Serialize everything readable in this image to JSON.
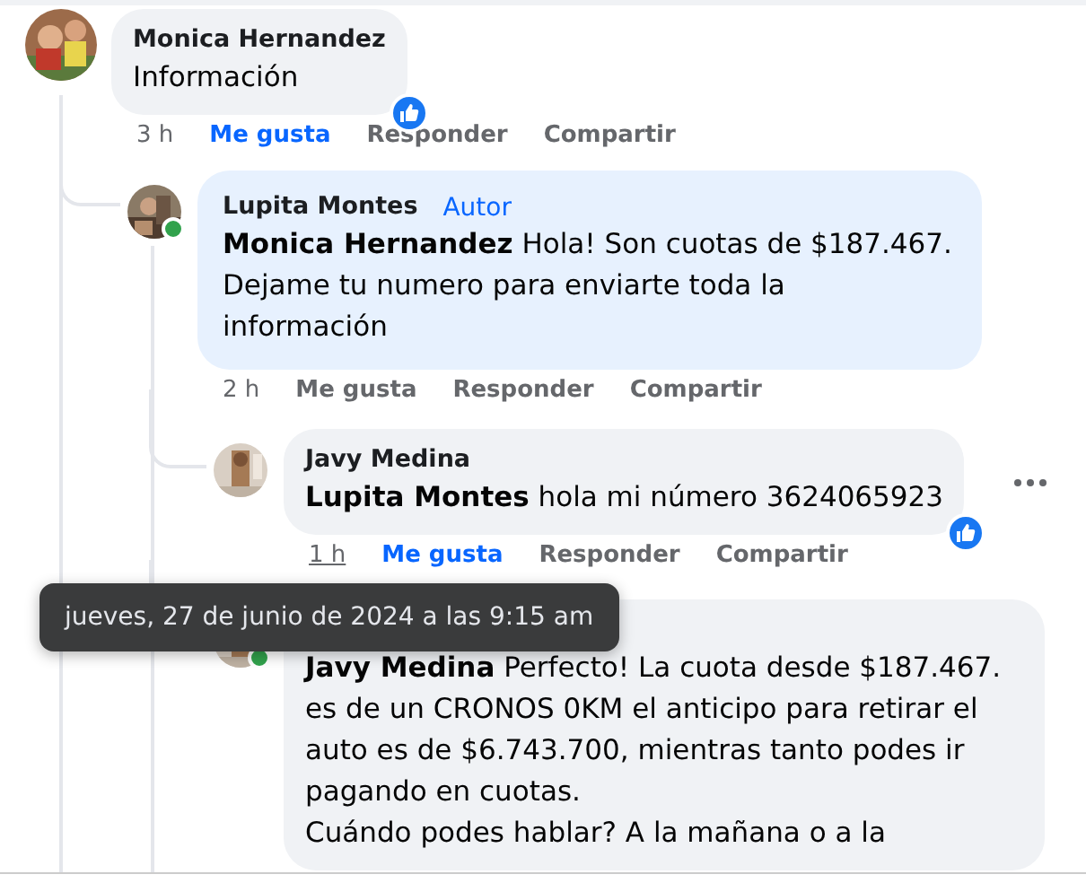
{
  "comments": [
    {
      "author": "Monica Hernandez",
      "text": "Información",
      "reaction_badge": true,
      "actions": {
        "time": "3 h",
        "like": "Me gusta",
        "liked": true,
        "reply": "Responder",
        "share": "Compartir"
      },
      "children": [
        {
          "author": "Lupita Montes",
          "text": "**Monica Hernandez** Hola! Son cuotas de $187.467. Dejame tu numero para enviarte toda la información",
          "online": true,
          "author_badge": "Autor",
          "highlighted": true,
          "actions": {
            "time": "2 h",
            "like": "Me gusta",
            "liked": false,
            "reply": "Responder",
            "share": "Compartir"
          },
          "children": [
            {
              "author": "Javy Medina",
              "text": "**Lupita Montes** hola mi número 3624065923",
              "reaction_badge": true,
              "more_button": true,
              "actions": {
                "time": "1 h",
                "time_underlined": true,
                "like": "Me gusta",
                "liked": true,
                "reply": "Responder",
                "share": "Compartir"
              }
            },
            {
              "text": "**Javy Medina** Perfecto! La cuota desde $187.467. es de un CRONOS 0KM el anticipo para retirar el auto es de $6.743.700, mientras tanto podes ir pagando en cuotas.\nCuándo podes hablar? A la mañana o a la",
              "online": true
            }
          ]
        }
      ]
    }
  ],
  "tooltip": "jueves, 27 de junio de 2024 a las 9:15 am"
}
